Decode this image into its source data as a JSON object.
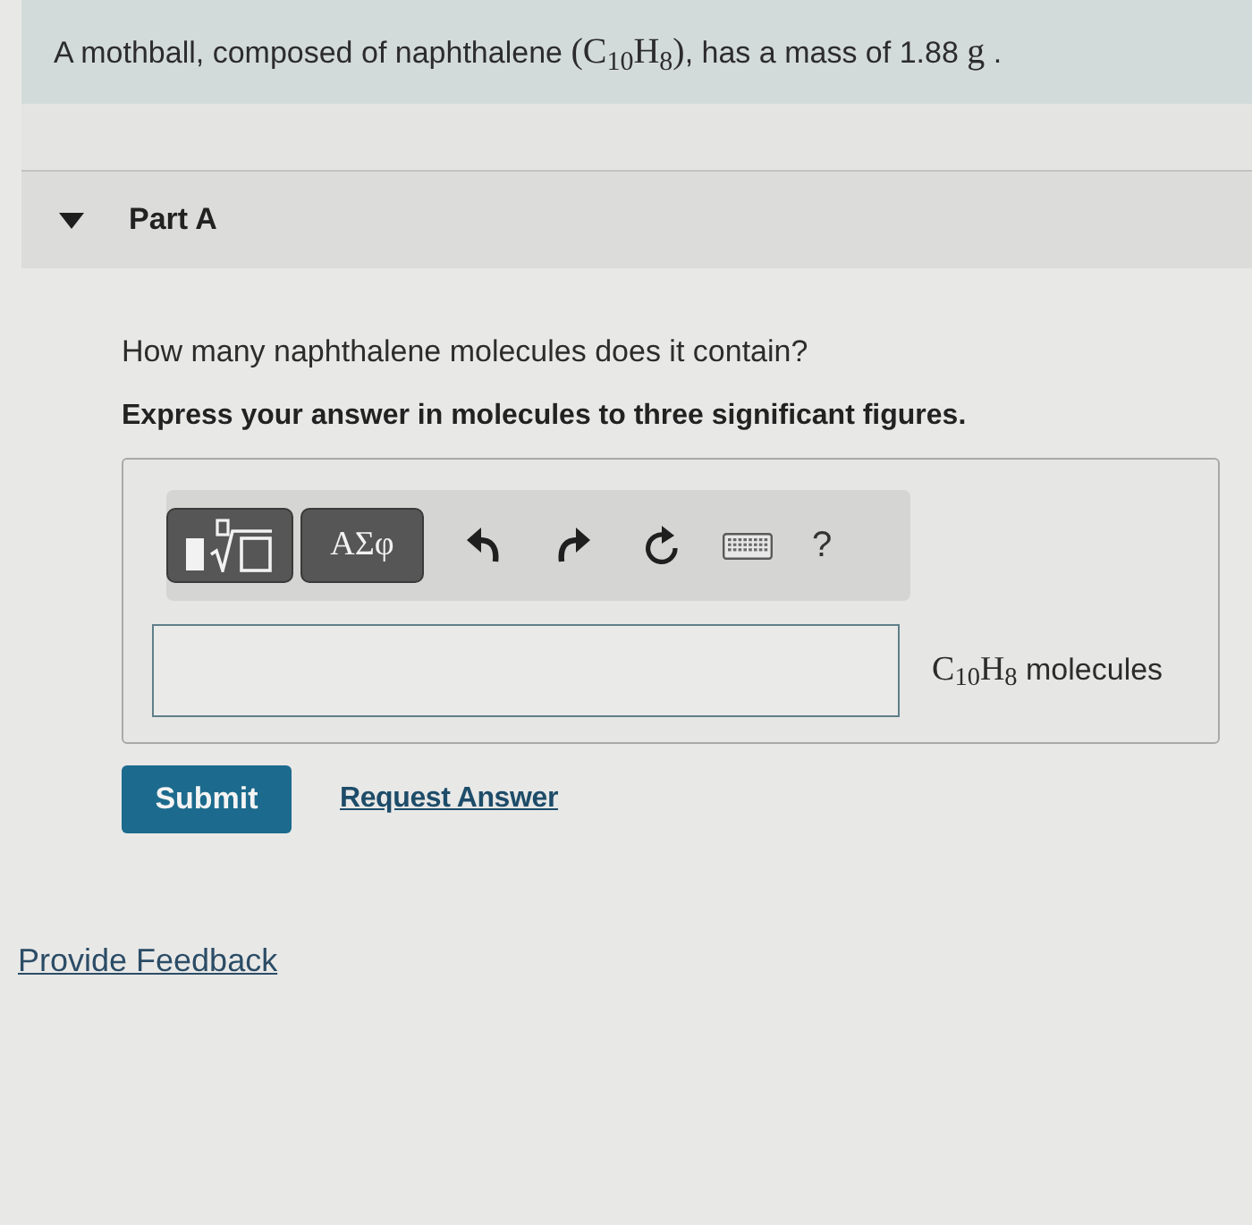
{
  "problem": {
    "segments": [
      {
        "kind": "text",
        "text": "A mothball, composed of naphthalene "
      },
      {
        "kind": "math",
        "text": "(C$_{10}$H$_{8}$)"
      },
      {
        "kind": "text",
        "text": ", has a mass of 1.88 "
      },
      {
        "kind": "math",
        "text": "g"
      },
      {
        "kind": "text",
        "text": " ."
      }
    ]
  },
  "part": {
    "label": "Part A",
    "expanded": true
  },
  "question": "How many naphthalene molecules does it contain?",
  "instruction": "Express your answer in molecules to three significant figures.",
  "toolbar": [
    {
      "kind": "template"
    },
    {
      "kind": "symbols",
      "label": "ΑΣφ"
    },
    {
      "kind": "undo"
    },
    {
      "kind": "redo"
    },
    {
      "kind": "reset"
    },
    {
      "kind": "keyboard"
    },
    {
      "kind": "help",
      "label": "?"
    }
  ],
  "answer": {
    "unit": [
      {
        "kind": "math",
        "text": "C$_{10}$H$_{8}$"
      },
      {
        "kind": "text",
        "text": " molecules"
      }
    ]
  },
  "actions": [
    {
      "kind": "primary",
      "label": "Submit"
    },
    {
      "kind": "link",
      "label": "Request Answer"
    }
  ],
  "feedback_link": "Provide Feedback"
}
